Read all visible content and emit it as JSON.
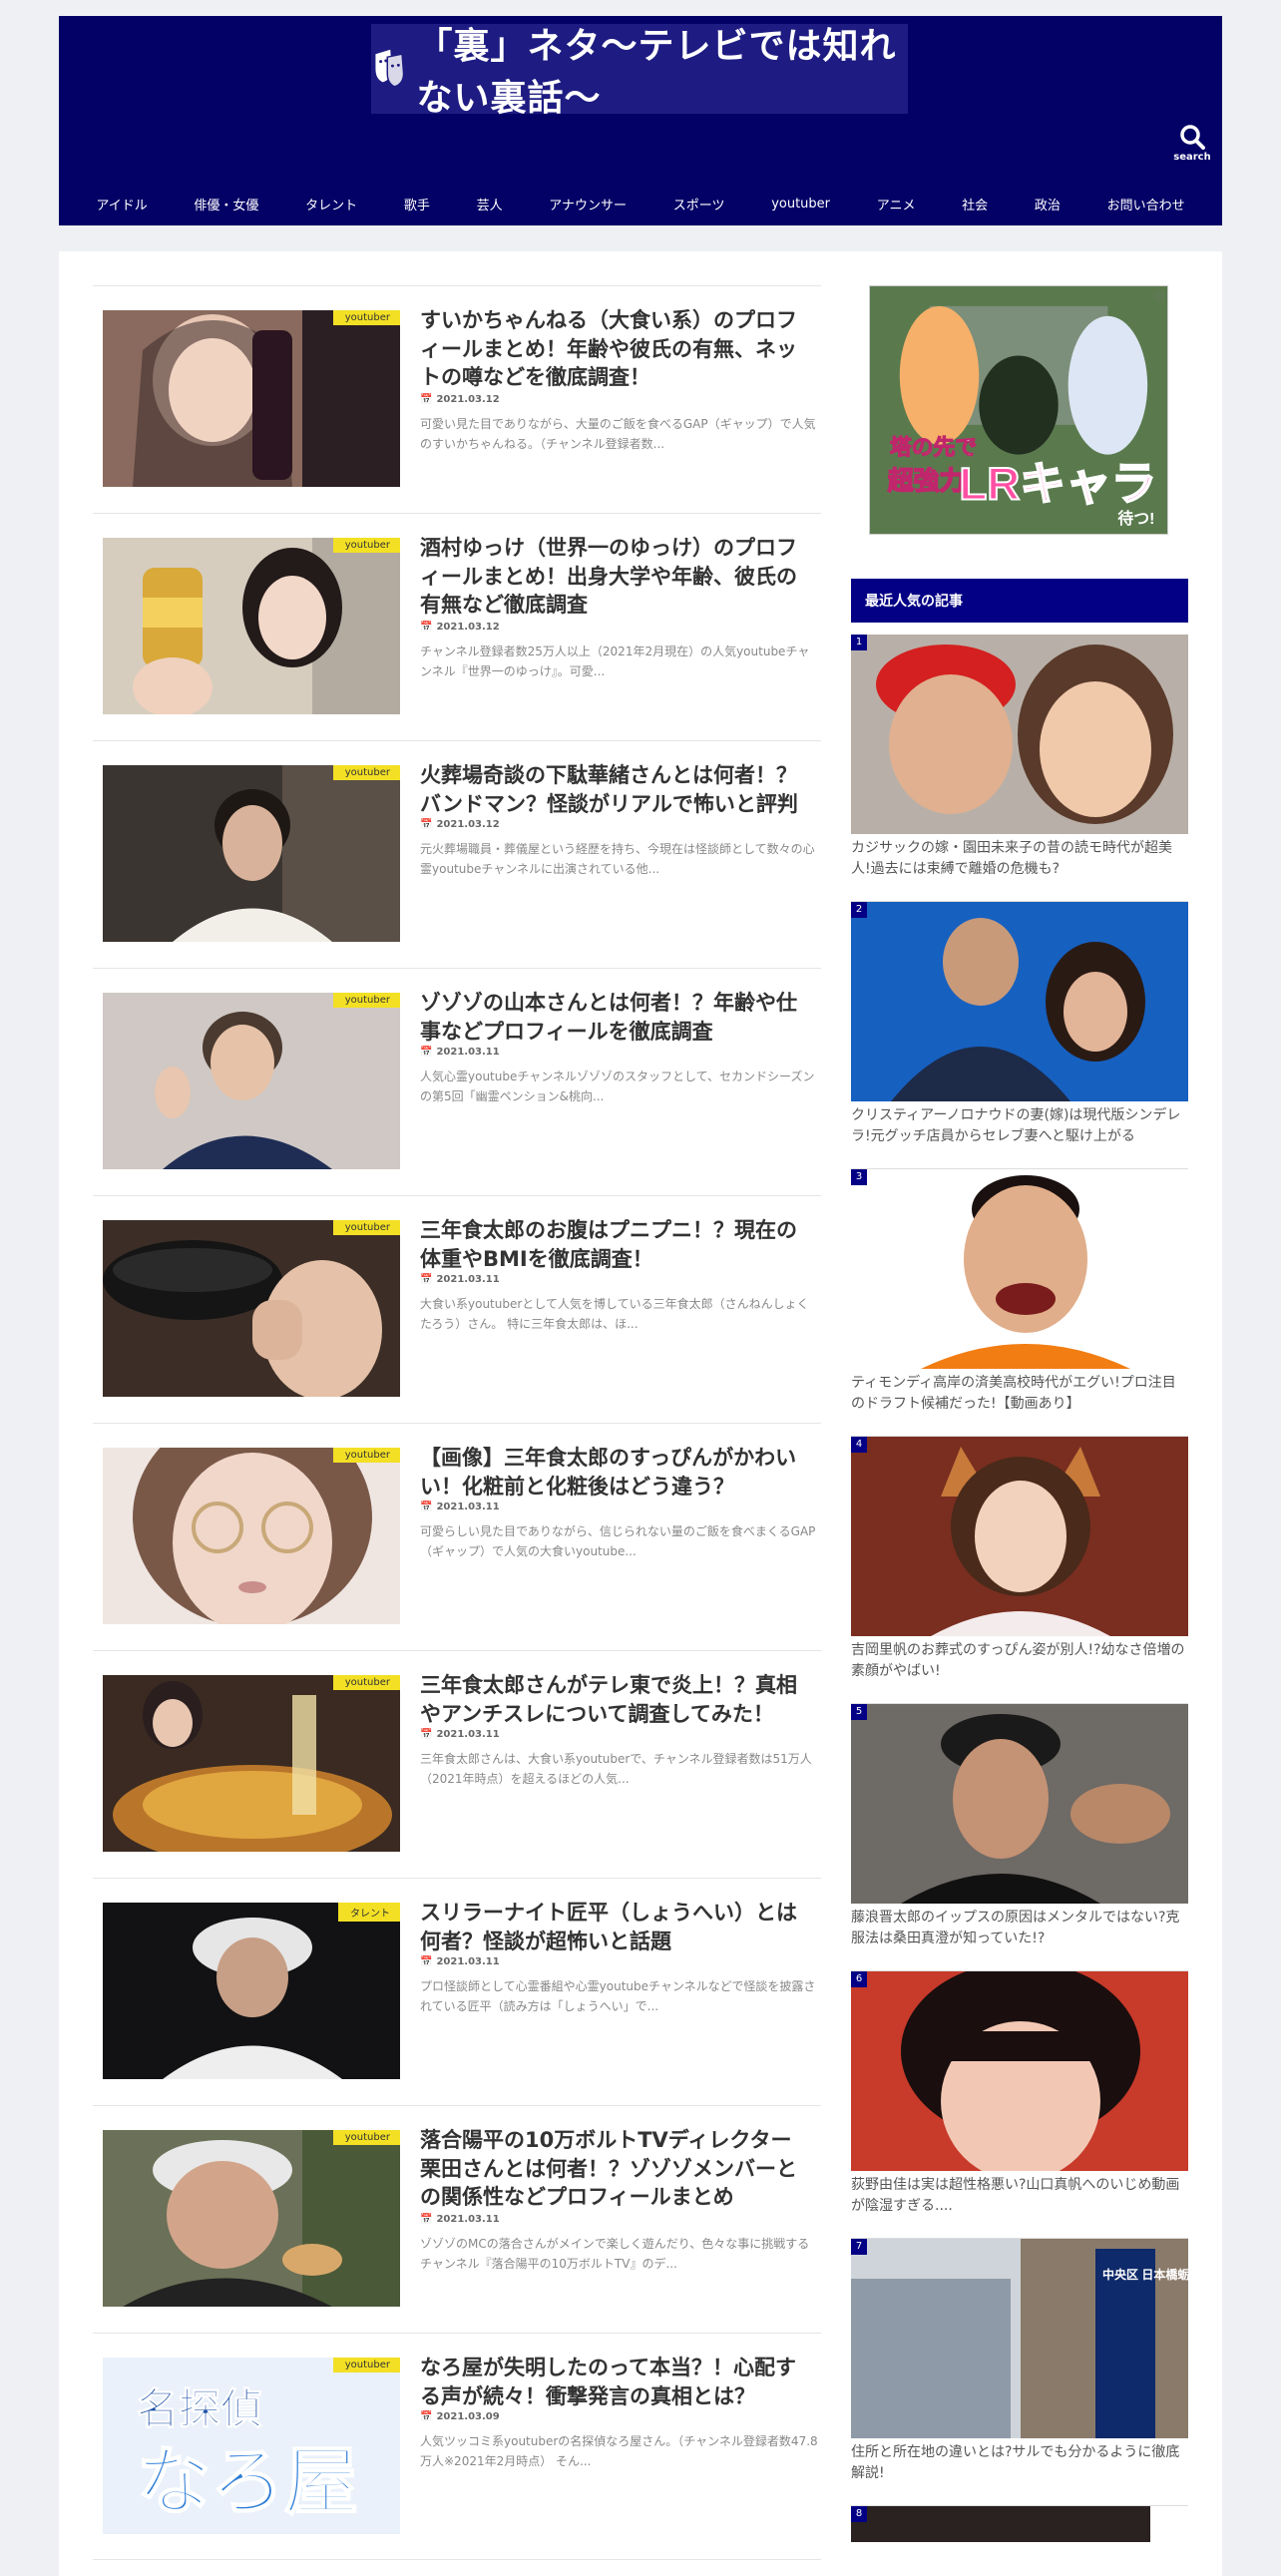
{
  "header": {
    "logo_text": "「裏」ネタ〜テレビでは知れない裏話〜",
    "search_label": "search",
    "nav": [
      "アイドル",
      "俳優・女優",
      "タレント",
      "歌手",
      "芸人",
      "アナウンサー",
      "スポーツ",
      "youtuber",
      "アニメ",
      "社会",
      "政治",
      "お問い合わせ"
    ]
  },
  "articles": [
    {
      "category": "youtuber",
      "title": "すいかちゃんねる（大食い系）のプロフィールまとめ！年齢や彼氏の有無、ネットの噂などを徹底調査！",
      "date": "2021.03.12",
      "excerpt": "可愛い見た目でありながら、大量のご飯を食べるGAP（ギャップ）で人気のすいかちゃんねる。（チャンネル登録者数..."
    },
    {
      "category": "youtuber",
      "title": "酒村ゆっけ（世界一のゆっけ）のプロフィールまとめ！出身大学や年齢、彼氏の有無など徹底調査",
      "date": "2021.03.12",
      "excerpt": "チャンネル登録者数25万人以上（2021年2月現在）の人気youtubeチャンネル『世界一のゆっけ』。可愛..."
    },
    {
      "category": "youtuber",
      "title": "火葬場奇談の下駄華緒さんとは何者！？バンドマン？怪談がリアルで怖いと評判",
      "date": "2021.03.12",
      "excerpt": "元火葬場職員・葬儀屋という経歴を持ち、今現在は怪談師として数々の心霊youtubeチャンネルに出演されている他..."
    },
    {
      "category": "youtuber",
      "title": "ゾゾゾの山本さんとは何者！？年齢や仕事などプロフィールを徹底調査",
      "date": "2021.03.11",
      "excerpt": "人気心霊youtubeチャンネルゾゾゾのスタッフとして、セカンドシーズンの第5回「幽霊ペンション&桃向..."
    },
    {
      "category": "youtuber",
      "title": "三年食太郎のお腹はプニプニ！？現在の体重やBMIを徹底調査！",
      "date": "2021.03.11",
      "excerpt": "大食い系youtuberとして人気を博している三年食太郎（さんねんしょくたろう）さん。 特に三年食太郎は、ほ..."
    },
    {
      "category": "youtuber",
      "title": "【画像】三年食太郎のすっぴんがかわいい！化粧前と化粧後はどう違う？",
      "date": "2021.03.11",
      "excerpt": "可愛らしい見た目でありながら、信じられない量のご飯を食べまくるGAP（ギャップ）で人気の大食いyoutube..."
    },
    {
      "category": "youtuber",
      "title": "三年食太郎さんがテレ東で炎上！？真相やアンチスレについて調査してみた！",
      "date": "2021.03.11",
      "excerpt": "三年食太郎さんは、大食い系youtuberで、チャンネル登録者数は51万人（2021年時点）を超えるほどの人気..."
    },
    {
      "category": "タレント",
      "title": "スリラーナイト匠平（しょうへい）とは何者？怪談が超怖いと話題",
      "date": "2021.03.11",
      "excerpt": "プロ怪談師として心霊番組や心霊youtubeチャンネルなどで怪談を披露されている匠平（読み方は「しょうへい」で..."
    },
    {
      "category": "youtuber",
      "title": "落合陽平の10万ボルトTVディレクター栗田さんとは何者！？ゾゾゾメンバーとの関係性などプロフィールまとめ",
      "date": "2021.03.11",
      "excerpt": "ゾゾゾのMCの落合さんがメインで楽しく遊んだり、色々な事に挑戦するチャンネル『落合陽平の10万ボルトTV』のデ..."
    },
    {
      "category": "youtuber",
      "title": "なろ屋が失明したのって本当？！心配する声が続々！衝撃発言の真相とは？",
      "date": "2021.03.09",
      "excerpt": "人気ツッコミ系youtuberの名探偵なろ屋さん。（チャンネル登録者数47.8万人※2021年2月時点） そん...",
      "thumb_text_1": "名探偵",
      "thumb_text_2": "なろ屋"
    }
  ],
  "sidebar": {
    "ad_badge": "ⓘ",
    "ad_text_1": "塔の先で",
    "ad_text_2": "超強力",
    "ad_text_3": "LRキャラ",
    "ad_text_4": "待つ!",
    "popular_title": "最近人気の記事",
    "popular": [
      {
        "rank": "1",
        "title": "カジサックの嫁・園田未来子の昔の読モ時代が超美人!過去には束縛で離婚の危機も?"
      },
      {
        "rank": "2",
        "title": "クリスティアーノロナウドの妻(嫁)は現代版シンデレラ!元グッチ店員からセレブ妻へと駆け上がる"
      },
      {
        "rank": "3",
        "title": "ティモンディ高岸の済美高校時代がエグい!プロ注目のドラフト候補だった!【動画あり】"
      },
      {
        "rank": "4",
        "title": "吉岡里帆のお葬式のすっぴん姿が別人!?幼なさ倍増の素顔がやばい!"
      },
      {
        "rank": "5",
        "title": "藤浪晋太郎のイップスの原因はメンタルではない?克服法は桑田真澄が知っていた!?"
      },
      {
        "rank": "6",
        "title": "荻野由佳は実は超性格悪い?山口真帆へのいじめ動画が陰湿すぎる...."
      },
      {
        "rank": "7",
        "title": "住所と所在地の違いとは?サルでも分かるように徹底解説!"
      },
      {
        "rank": "8",
        "title": ""
      }
    ],
    "sign_text": "中央区 日本橋蛎殻町"
  }
}
